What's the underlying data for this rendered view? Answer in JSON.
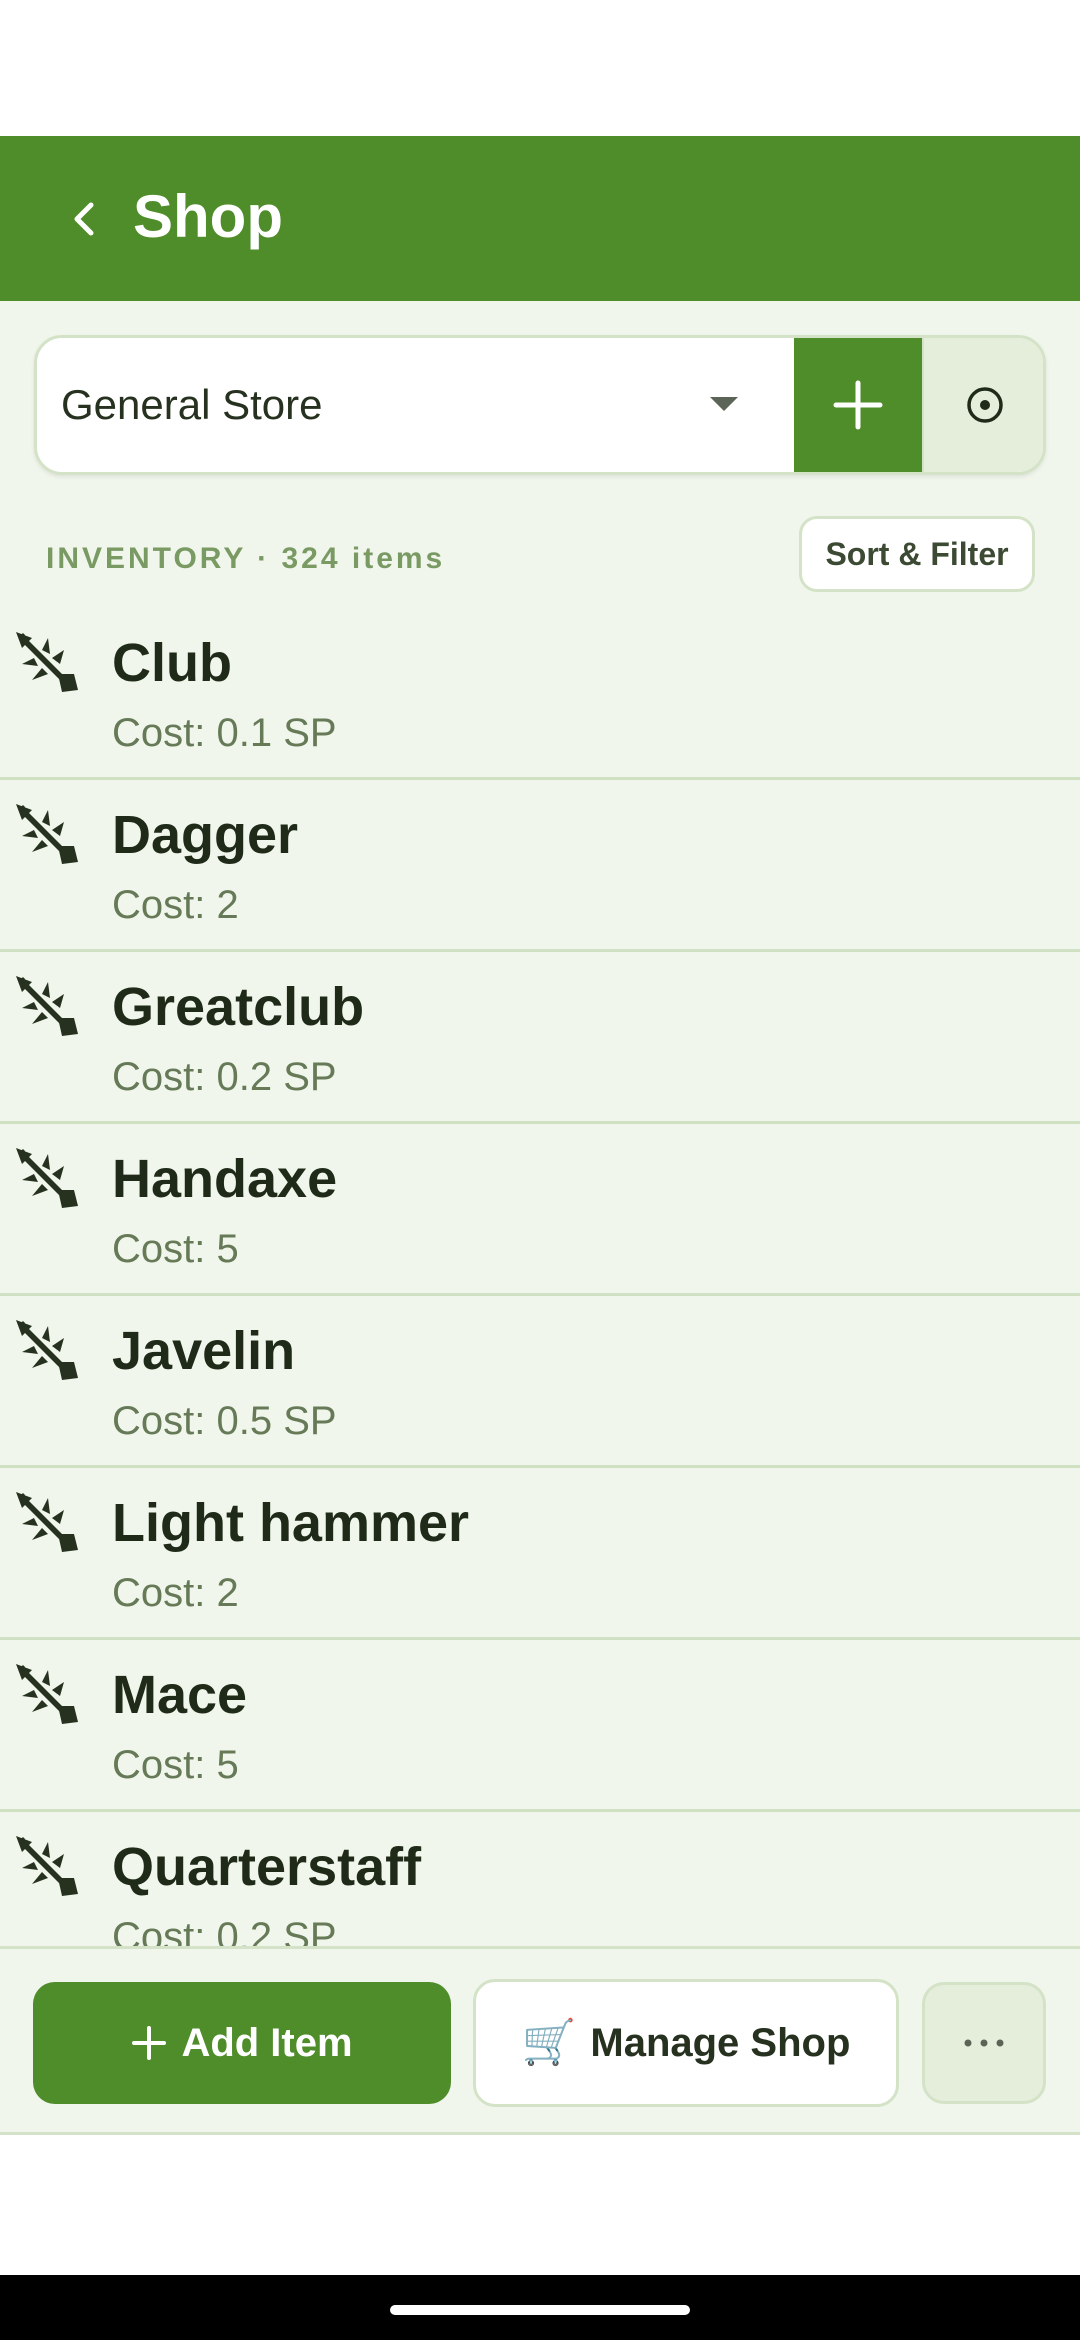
{
  "app_bar": {
    "title": "Shop",
    "back_icon": "chevron-left-icon"
  },
  "shop_selector": {
    "selected": "General Store",
    "add_icon": "plus-icon",
    "locate_icon": "target-icon"
  },
  "inventory": {
    "label": "INVENTORY · 324 items",
    "sort_filter_label": "Sort & Filter"
  },
  "items": [
    {
      "name": "Club",
      "cost": "Cost: 0.1 SP",
      "icon": "weapon-icon"
    },
    {
      "name": "Dagger",
      "cost": "Cost: 2",
      "icon": "weapon-icon"
    },
    {
      "name": "Greatclub",
      "cost": "Cost: 0.2 SP",
      "icon": "weapon-icon"
    },
    {
      "name": "Handaxe",
      "cost": "Cost: 5",
      "icon": "weapon-icon"
    },
    {
      "name": "Javelin",
      "cost": "Cost: 0.5 SP",
      "icon": "weapon-icon"
    },
    {
      "name": "Light hammer",
      "cost": "Cost: 2",
      "icon": "weapon-icon"
    },
    {
      "name": "Mace",
      "cost": "Cost: 5",
      "icon": "weapon-icon"
    },
    {
      "name": "Quarterstaff",
      "cost": "Cost: 0.2 SP",
      "icon": "weapon-icon"
    }
  ],
  "bottom_bar": {
    "add_item_label": "Add Item",
    "manage_shop_label": "Manage Shop",
    "cart_glyph": "🛒",
    "more_icon": "more-horizontal-icon"
  },
  "colors": {
    "primary": "#4f8c2a",
    "background": "#f1f6ec",
    "divider": "#d0e0c3"
  }
}
